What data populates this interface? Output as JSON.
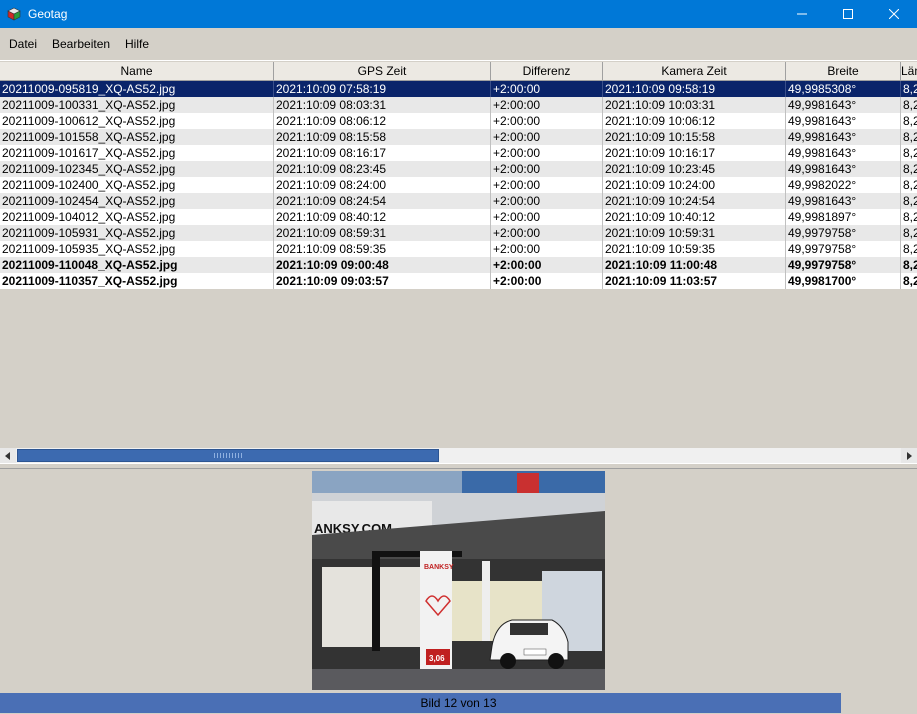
{
  "window": {
    "title": "Geotag",
    "icon": "dice-cube-icon"
  },
  "menu": [
    "Datei",
    "Bearbeiten",
    "Hilfe"
  ],
  "table": {
    "columns": [
      "Name",
      "GPS Zeit",
      "Differenz",
      "Kamera Zeit",
      "Breite",
      "Länge"
    ],
    "rows": [
      {
        "name": "20211009-095819_XQ-AS52.jpg",
        "gps": "2021:10:09 07:58:19",
        "diff": "+2:00:00",
        "cam": "2021:10:09 09:58:19",
        "lat": "49,9985308°",
        "lon": "8,2",
        "selected": true,
        "bold": false
      },
      {
        "name": "20211009-100331_XQ-AS52.jpg",
        "gps": "2021:10:09 08:03:31",
        "diff": "+2:00:00",
        "cam": "2021:10:09 10:03:31",
        "lat": "49,9981643°",
        "lon": "8,2",
        "selected": false,
        "bold": false
      },
      {
        "name": "20211009-100612_XQ-AS52.jpg",
        "gps": "2021:10:09 08:06:12",
        "diff": "+2:00:00",
        "cam": "2021:10:09 10:06:12",
        "lat": "49,9981643°",
        "lon": "8,2",
        "selected": false,
        "bold": false
      },
      {
        "name": "20211009-101558_XQ-AS52.jpg",
        "gps": "2021:10:09 08:15:58",
        "diff": "+2:00:00",
        "cam": "2021:10:09 10:15:58",
        "lat": "49,9981643°",
        "lon": "8,2",
        "selected": false,
        "bold": false
      },
      {
        "name": "20211009-101617_XQ-AS52.jpg",
        "gps": "2021:10:09 08:16:17",
        "diff": "+2:00:00",
        "cam": "2021:10:09 10:16:17",
        "lat": "49,9981643°",
        "lon": "8,2",
        "selected": false,
        "bold": false
      },
      {
        "name": "20211009-102345_XQ-AS52.jpg",
        "gps": "2021:10:09 08:23:45",
        "diff": "+2:00:00",
        "cam": "2021:10:09 10:23:45",
        "lat": "49,9981643°",
        "lon": "8,2",
        "selected": false,
        "bold": false
      },
      {
        "name": "20211009-102400_XQ-AS52.jpg",
        "gps": "2021:10:09 08:24:00",
        "diff": "+2:00:00",
        "cam": "2021:10:09 10:24:00",
        "lat": "49,9982022°",
        "lon": "8,2",
        "selected": false,
        "bold": false
      },
      {
        "name": "20211009-102454_XQ-AS52.jpg",
        "gps": "2021:10:09 08:24:54",
        "diff": "+2:00:00",
        "cam": "2021:10:09 10:24:54",
        "lat": "49,9981643°",
        "lon": "8,2",
        "selected": false,
        "bold": false
      },
      {
        "name": "20211009-104012_XQ-AS52.jpg",
        "gps": "2021:10:09 08:40:12",
        "diff": "+2:00:00",
        "cam": "2021:10:09 10:40:12",
        "lat": "49,9981897°",
        "lon": "8,2",
        "selected": false,
        "bold": false
      },
      {
        "name": "20211009-105931_XQ-AS52.jpg",
        "gps": "2021:10:09 08:59:31",
        "diff": "+2:00:00",
        "cam": "2021:10:09 10:59:31",
        "lat": "49,9979758°",
        "lon": "8,2",
        "selected": false,
        "bold": false
      },
      {
        "name": "20211009-105935_XQ-AS52.jpg",
        "gps": "2021:10:09 08:59:35",
        "diff": "+2:00:00",
        "cam": "2021:10:09 10:59:35",
        "lat": "49,9979758°",
        "lon": "8,2",
        "selected": false,
        "bold": false
      },
      {
        "name": "20211009-110048_XQ-AS52.jpg",
        "gps": "2021:10:09 09:00:48",
        "diff": "+2:00:00",
        "cam": "2021:10:09 11:00:48",
        "lat": "49,9979758°",
        "lon": "8,2",
        "selected": false,
        "bold": true
      },
      {
        "name": "20211009-110357_XQ-AS52.jpg",
        "gps": "2021:10:09 09:03:57",
        "diff": "+2:00:00",
        "cam": "2021:10:09 11:03:57",
        "lat": "49,9981700°",
        "lon": "8,2",
        "selected": false,
        "bold": true
      }
    ]
  },
  "preview": {
    "sign_text": "ANKSY.COM",
    "poster_text": "BANKSY",
    "price_tag": "3,06"
  },
  "status": {
    "text": "Bild 12 von 13",
    "progress": 0.917
  },
  "colors": {
    "titlebar": "#0078d7",
    "selection": "#0a246a",
    "progress": "#4a6fb5",
    "scroll_thumb": "#3c6ab0"
  }
}
